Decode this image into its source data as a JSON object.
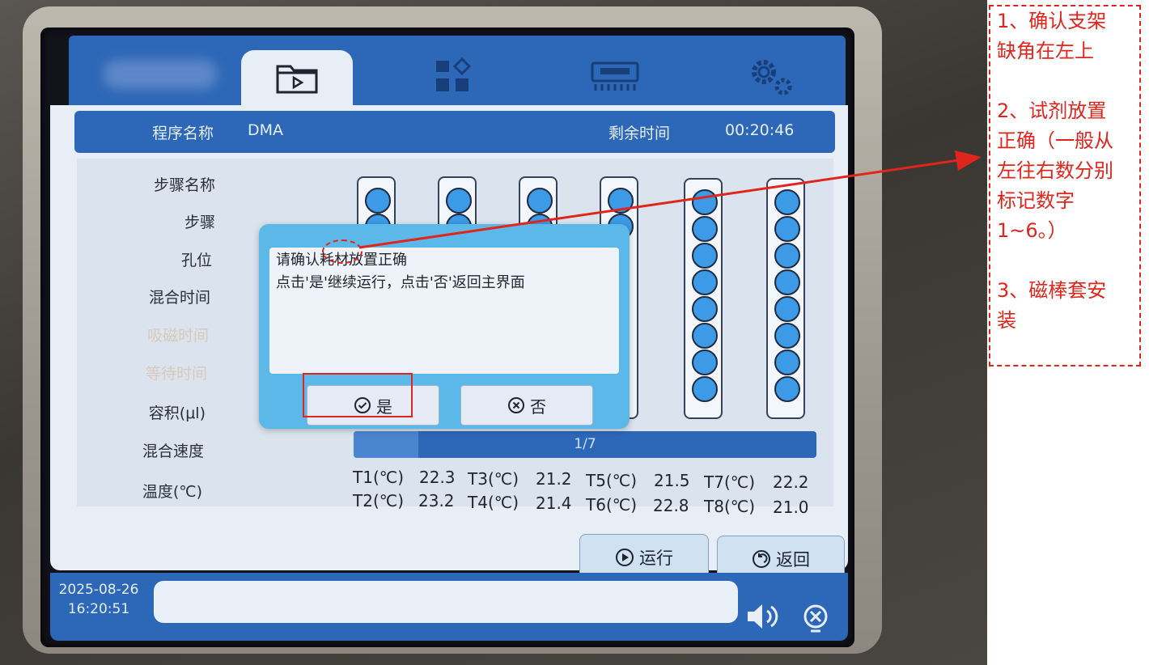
{
  "status": {
    "program_label": "程序名称",
    "program_value": "DMA",
    "remaining_label": "剩余时间",
    "remaining_value": "00:20:46"
  },
  "params": [
    "步骤名称",
    "步骤",
    "孔位",
    "混合时间",
    "吸磁时间",
    "等待时间",
    "容积(μl)",
    "混合速度",
    "温度(℃)"
  ],
  "progress": {
    "text": "1/7",
    "fraction": 0.14
  },
  "temperatures": {
    "row1": [
      "T1(℃)",
      "22.3",
      "T3(℃)",
      "21.2",
      "T5(℃)",
      "21.5",
      "T7(℃)",
      "22.2"
    ],
    "row2": [
      "T2(℃)",
      "23.2",
      "T4(℃)",
      "21.4",
      "T6(℃)",
      "22.8",
      "T8(℃)",
      "21.0"
    ]
  },
  "buttons": {
    "run": "运行",
    "back": "返回"
  },
  "footer": {
    "date": "2025-08-26",
    "time": "16:20:51"
  },
  "dialog": {
    "line1": "请确认耗材放置正确",
    "line2": "点击'是'继续运行，点击'否'返回主界面",
    "yes": "是",
    "no": "否"
  },
  "annotation": {
    "item1": "1、确认支架\n缺角在左上",
    "item2": "2、试剂放置\n正确（一般从\n左往右数分别\n标记数字\n1~6。）",
    "item3": "3、磁棒套安\n装"
  },
  "colors": {
    "accent": "#2d67b7",
    "dialog": "#5bb8e8",
    "annotation": "#e0251c"
  },
  "icons": [
    "folder-play-icon",
    "grid-icon",
    "instrument-icon",
    "settings-gears-icon",
    "play-icon",
    "return-icon",
    "speaker-icon",
    "close-icon",
    "check-icon",
    "cancel-icon"
  ]
}
